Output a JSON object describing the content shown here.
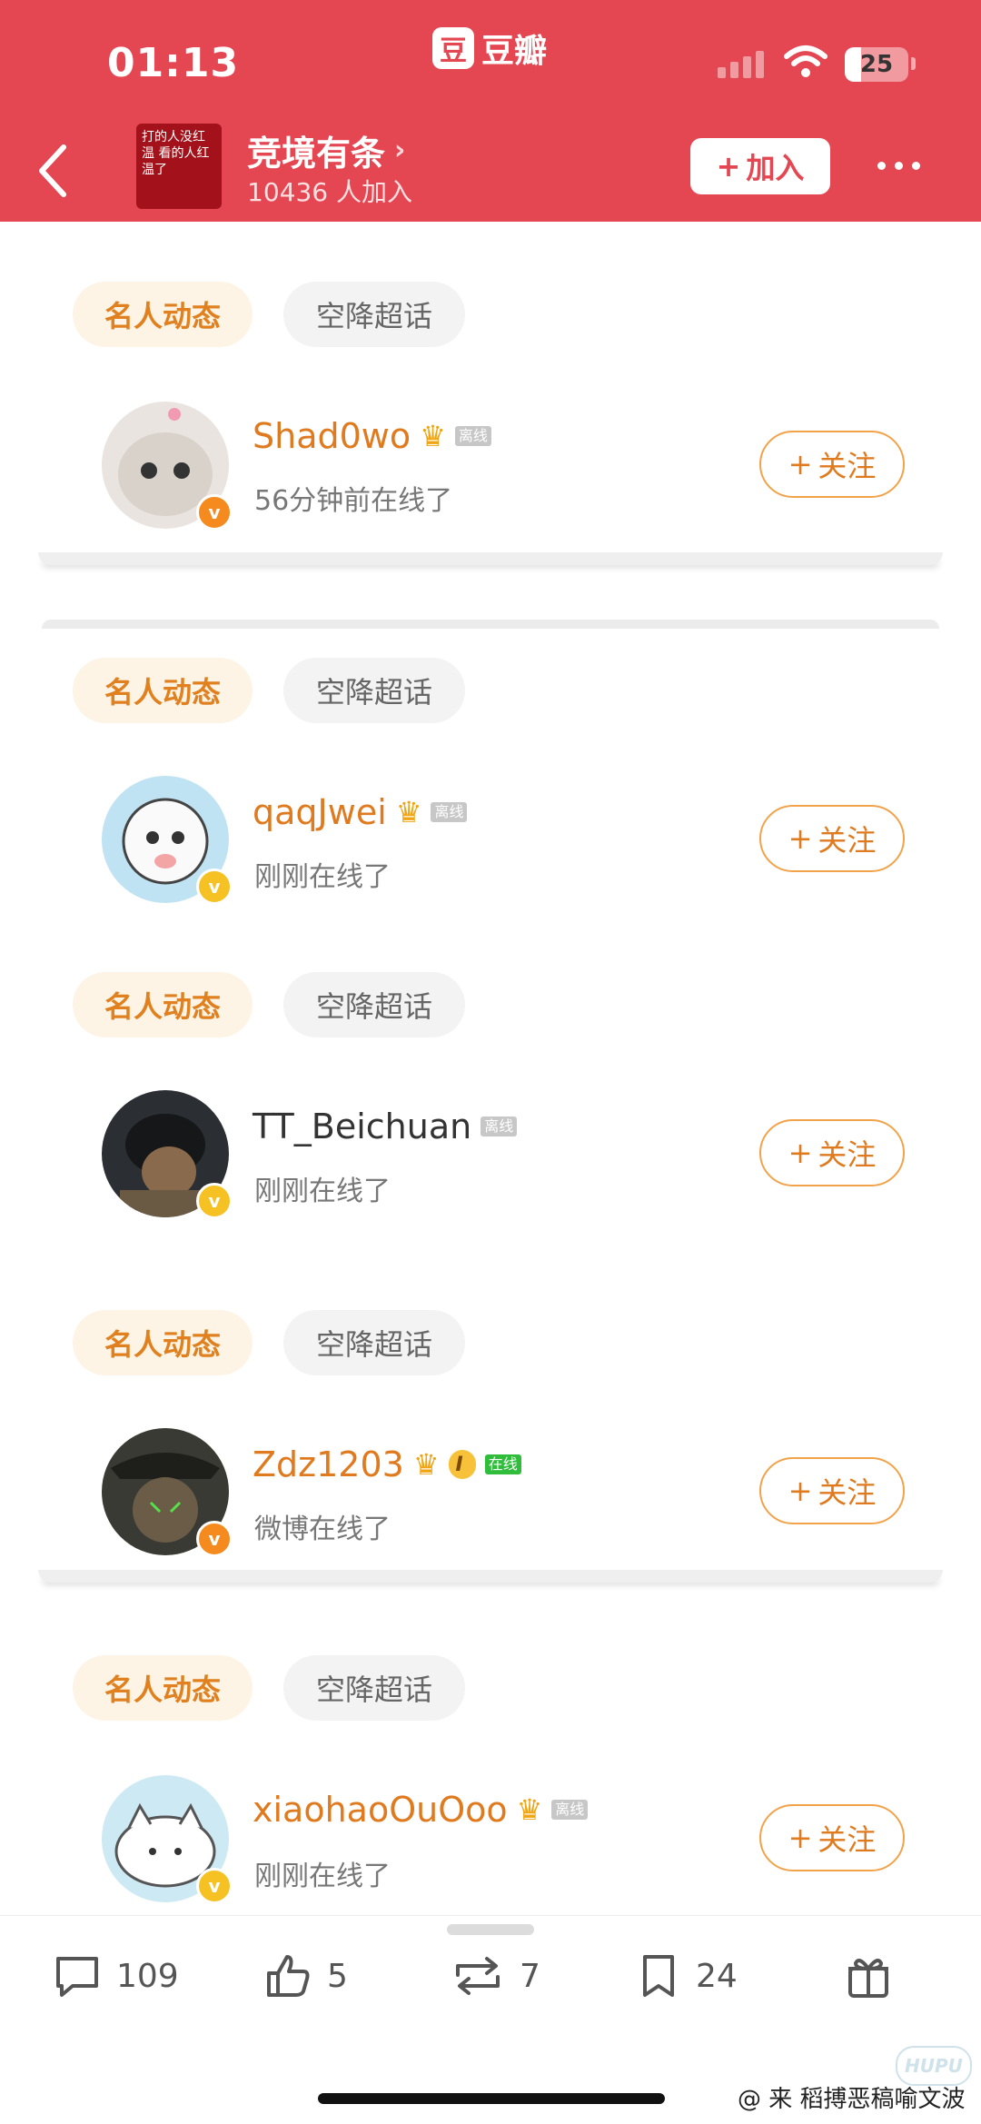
{
  "status_bar": {
    "time": "01:13",
    "battery": "25",
    "battery_level_pct": 25
  },
  "app_badge": {
    "logo_char": "豆",
    "name": "豆瓣"
  },
  "header": {
    "group_name": "竞境有条",
    "group_members": "10436 人加入",
    "join_label": "加入",
    "group_avatar_text": "打的人没红温 看的人红温了"
  },
  "cards": [
    {
      "tabs": [
        "名人动态",
        "空降超话"
      ],
      "user": {
        "name": "Shad0wo",
        "status_tag": "离线",
        "status": "56分钟前在线了"
      }
    },
    {
      "tabs": [
        "名人动态",
        "空降超话"
      ],
      "user": {
        "name": "qaqJwei",
        "status_tag": "离线",
        "status": "刚刚在线了"
      }
    },
    {
      "tabs": [
        "名人动态",
        "空降超话"
      ],
      "user": {
        "name": "TT_Beichuan",
        "status_tag": "离线",
        "status": "刚刚在线了"
      }
    },
    {
      "tabs": [
        "名人动态",
        "空降超话"
      ],
      "user": {
        "name": "Zdz1203",
        "level": "I",
        "status_tag": "在线",
        "status": "微博在线了"
      }
    },
    {
      "tabs": [
        "名人动态",
        "空降超话"
      ],
      "user": {
        "name": "xiaohaoOuOoo",
        "status_tag": "离线",
        "status": "刚刚在线了"
      }
    }
  ],
  "follow_label": "关注",
  "actions": {
    "comments": "109",
    "likes": "5",
    "reposts": "7",
    "favorites": "24"
  },
  "watermark": "@ 来 稻搏恶稿喻文波",
  "hupu_mark": "HUPU"
}
